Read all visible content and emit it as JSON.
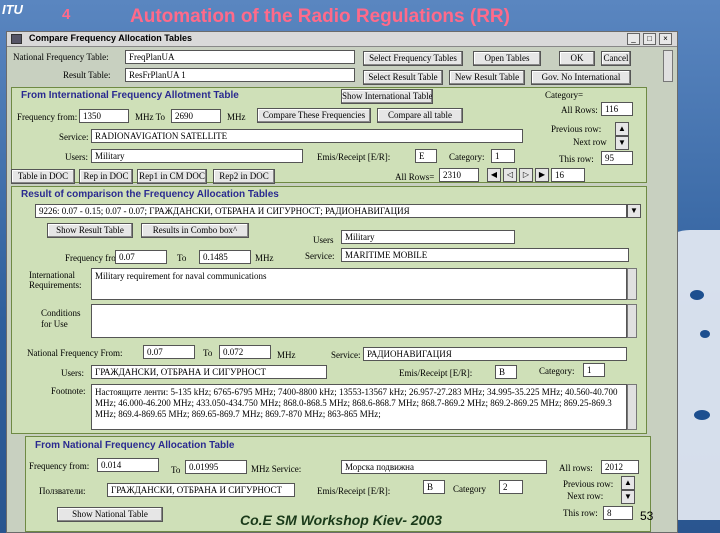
{
  "slide": {
    "title": "Automation of the Radio Regulations (RR)",
    "logo_text": "ITU",
    "number_top": "4",
    "footer": "Co.E SM Workshop Kiev- 2003",
    "page": "53"
  },
  "window": {
    "title": "Compare Frequency Allocation Tables",
    "min": "_",
    "max": "□",
    "close": "×"
  },
  "top": {
    "national_table_label": "National Frequency Table:",
    "national_table_value": "FreqPlanUA",
    "result_table_label": "Result Table:",
    "result_table_value": "ResFrPlanUA 1",
    "btn_select_freq": "Select Frequency Tables",
    "btn_open_tables": "Open Tables",
    "btn_ok": "OK",
    "btn_cancel": "Cancel",
    "btn_select_result": "Select Result Table",
    "btn_new_result": "New Result Table",
    "btn_gov": "Gov. No International"
  },
  "intl": {
    "header": "From International Frequency Allotment Table",
    "btn_show_intl": "Show International Table",
    "freq_from_label": "Frequency from:",
    "freq_from": "1350",
    "mhz_to_label": "MHz To",
    "freq_to": "2690",
    "mhz": "MHz",
    "btn_compare_these": "Compare These Frequencies",
    "btn_compare_all": "Compare all table",
    "service_label": "Service:",
    "service": "RADIONAVIGATION SATELLITE",
    "users_label": "Users:",
    "users": "Military",
    "emis_label": "Emis/Receipt [E/R]:",
    "emis": "E",
    "category_label": "Category:",
    "category": "1",
    "category_eq": "Category=",
    "all_rows_label": "All Rows:",
    "all_rows": "116",
    "prev_row": "Previous row:",
    "next_row": "Next row",
    "this_row_label": "This row:",
    "this_row": "95"
  },
  "docbar": {
    "btn_table_doc": "Table in DOC",
    "btn_rep_doc": "Rep in DOC",
    "btn_rep1": "Rep1 in CM DOC",
    "btn_rep2": "Rep2 in DOC",
    "all_rows_label": "All Rows=",
    "all_rows": "2310",
    "count": "16"
  },
  "result": {
    "header": "Result of comparison the Frequency Allocation Tables",
    "combo": "9226: 0.07 - 0.15; 0.07 - 0.07; ГРАЖДАНСКИ, ОТБРАНА И СИГУРНОСТ; РАДИОНАВИГАЦИЯ",
    "btn_show_result": "Show Result Table",
    "btn_result_combo": "Results in Combo box^",
    "users_label": "Users",
    "users": "Military",
    "freq_from_label": "Frequency from",
    "freq_from": "0.07",
    "to_label": "To",
    "freq_to": "0.1485",
    "mhz": "MHz",
    "service_label": "Service:",
    "service": "MARITIME MOBILE",
    "intl_req_label": "International Requirements:",
    "intl_req": "Military requirement for naval communications",
    "conditions_label": "Conditions for Use",
    "conditions": "",
    "nat_freq_label": "National Frequency From:",
    "nat_freq_from": "0.07",
    "nat_to_label": "To",
    "nat_freq_to": "0.072",
    "nat_mhz": "MHz",
    "nat_service_label": "Service:",
    "nat_service": "РАДИОНАВИГАЦИЯ",
    "nat_users_label": "Users:",
    "nat_users": "ГРАЖДАНСКИ, ОТБРАНА И СИГУРНОСТ",
    "nat_emis_label": "Emis/Receipt [E/R]:",
    "nat_emis": "B",
    "nat_category_label": "Category:",
    "nat_category": "1",
    "footnote_label": "Footnote:",
    "footnote": "Настоящите ленти: 5-135 kHz; 6765-6795 MHz; 7400-8800 kHz; 13553-13567 kHz; 26.957-27.283 MHz; 34.995-35.225 MHz; 40.560-40.700 MHz; 46.000-46.200 MHz; 433.050-434.750 MHz; 868.0-868.5 MHz; 868.6-868.7 MHz; 868.7-869.2 MHz; 869.2-869.25 MHz; 869.25-869.3 MHz; 869.4-869.65 MHz; 869.65-869.7 MHz; 869.7-870 MHz; 863-865 MHz;"
  },
  "national": {
    "header": "From National Frequency Allocation Table",
    "freq_from_label": "Frequency from:",
    "freq_from": "0.014",
    "to_label": "To",
    "freq_to": "0.01995",
    "mhz_service_label": "MHz Service:",
    "service": "Морска подвижна",
    "users_label": "Ползватели:",
    "users": "ГРАЖДАНСКИ, ОТБРАНА И СИГУРНОСТ",
    "emis_label": "Emis/Receipt [E/R]:",
    "emis": "B",
    "category_label": "Category",
    "category": "2",
    "all_rows_label": "All rows:",
    "all_rows": "2012",
    "prev_row": "Previous row:",
    "next_row": "Next row:",
    "this_row_label": "This row:",
    "this_row": "8",
    "btn_show_national": "Show National Table"
  }
}
